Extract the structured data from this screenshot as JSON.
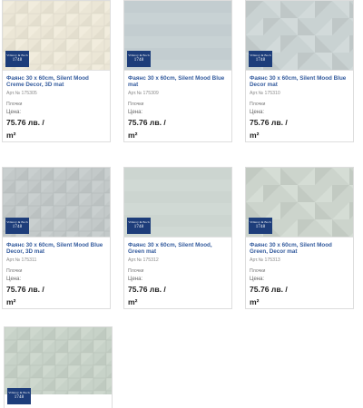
{
  "brand": {
    "logo_line1": "Villeroy & Boch",
    "logo_line2": "1748"
  },
  "labels": {
    "product_type": "Плочки",
    "price_label": "Цена:",
    "unit": "m²"
  },
  "products": [
    {
      "name": "Фаянс 30 x 60cm, Silent Mood Creme Decor, 3D mat",
      "sku": "Арт.№ 175305",
      "price": "75.76 лв. /",
      "tile_color": "#ebe6d6",
      "pattern": "3d-blocks"
    },
    {
      "name": "Фаянс 30 x 60cm, Silent Mood Blue mat",
      "sku": "Арт.№ 175309",
      "price": "75.76 лв. /",
      "tile_color": "#c5cfd1",
      "pattern": "plain"
    },
    {
      "name": "Фаянс 30 x 60cm, Silent Mood Blue Decor mat",
      "sku": "Арт.№ 175310",
      "price": "75.76 лв. /",
      "tile_color": "#c9d2d2",
      "pattern": "triangles"
    },
    {
      "name": "Фаянс 30 x 60cm, Silent Mood Blue Decor, 3D mat",
      "sku": "Арт.№ 175311",
      "price": "75.76 лв. /",
      "tile_color": "#c3c9c9",
      "pattern": "3d-blocks"
    },
    {
      "name": "Фаянс 30 x 60cm, Silent Mood, Green mat",
      "sku": "Арт.№ 175312",
      "price": "75.76 лв. /",
      "tile_color": "#ced7d1",
      "pattern": "plain"
    },
    {
      "name": "Фаянс 30 x 60cm, Silent Mood Green, Decor mat",
      "sku": "Арт.№ 175313",
      "price": "75.76 лв. /",
      "tile_color": "#ccd4cc",
      "pattern": "triangles"
    },
    {
      "tile_color": "#c7d2c8",
      "pattern": "3d-blocks"
    }
  ]
}
